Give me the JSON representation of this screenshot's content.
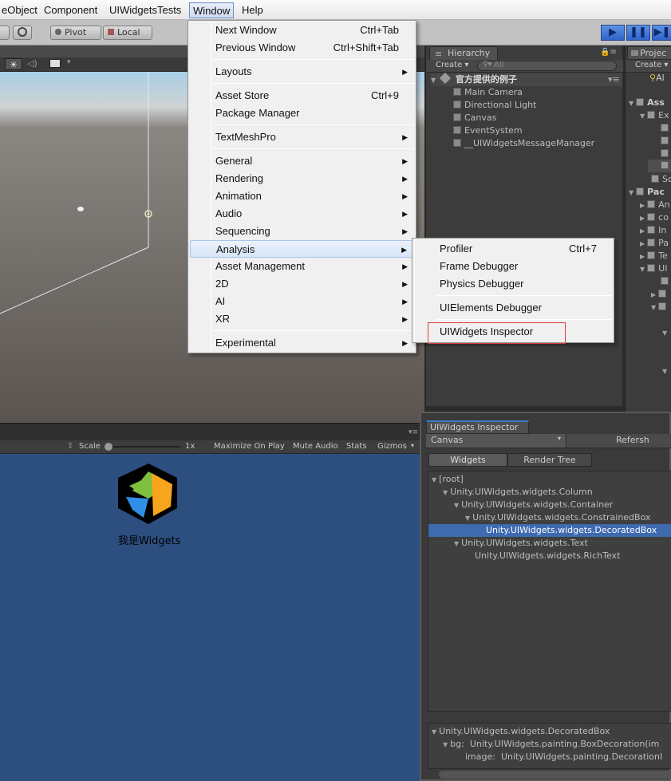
{
  "menubar": {
    "items": [
      "eObject",
      "Component",
      "UIWidgetsTests",
      "Window",
      "Help"
    ]
  },
  "toolbar": {
    "pivot": "Pivot",
    "local": "Local",
    "play_icon": "play-icon",
    "pause_icon": "pause-icon",
    "step_icon": "step-icon"
  },
  "window_menu": {
    "items": [
      {
        "label": "Next Window",
        "shortcut": "Ctrl+Tab"
      },
      {
        "label": "Previous Window",
        "shortcut": "Ctrl+Shift+Tab"
      },
      {
        "label": "Layouts",
        "shortcut": ""
      },
      {
        "label": "Asset Store",
        "shortcut": "Ctrl+9"
      },
      {
        "label": "Package Manager",
        "shortcut": ""
      },
      {
        "label": "TextMeshPro",
        "shortcut": ""
      },
      {
        "label": "General",
        "shortcut": ""
      },
      {
        "label": "Rendering",
        "shortcut": ""
      },
      {
        "label": "Animation",
        "shortcut": ""
      },
      {
        "label": "Audio",
        "shortcut": ""
      },
      {
        "label": "Sequencing",
        "shortcut": ""
      },
      {
        "label": "Analysis",
        "shortcut": ""
      },
      {
        "label": "Asset Management",
        "shortcut": ""
      },
      {
        "label": "2D",
        "shortcut": ""
      },
      {
        "label": "AI",
        "shortcut": ""
      },
      {
        "label": "XR",
        "shortcut": ""
      },
      {
        "label": "Experimental",
        "shortcut": ""
      }
    ]
  },
  "analysis_submenu": {
    "items": [
      {
        "label": "Profiler",
        "shortcut": "Ctrl+7"
      },
      {
        "label": "Frame Debugger",
        "shortcut": ""
      },
      {
        "label": "Physics Debugger",
        "shortcut": ""
      },
      {
        "label": "UIElements Debugger",
        "shortcut": ""
      },
      {
        "label": "UIWidgets Inspector",
        "shortcut": ""
      }
    ]
  },
  "hierarchy": {
    "tab": "Hierarchy",
    "create": "Create",
    "search_placeholder": "All",
    "scene": "官方提供的例子",
    "objects": [
      "Main Camera",
      "Directional Light",
      "Canvas",
      "EventSystem",
      "__UIWidgetsMessageManager"
    ]
  },
  "project": {
    "tab": "Projec",
    "create": "Create",
    "search": "Al",
    "rows": [
      "Ass",
      "Ex",
      "",
      "",
      "",
      "",
      "Sc",
      "Pac",
      "An",
      "co",
      "In",
      "Pa",
      "Te",
      "UI"
    ]
  },
  "game": {
    "scale_label": "Scale",
    "scale_value": "1x",
    "maximize": "Maximize On Play",
    "mute": "Mute Audio",
    "stats": "Stats",
    "gizmos": "Gizmos",
    "widget_text": "我是Widgets",
    "bg_color": "#2d4f80"
  },
  "inspector": {
    "tab": "UIWidgets Inspector",
    "panel_select": "Canvas",
    "refresh": "Refersh",
    "tabs": [
      "Widgets",
      "Render Tree"
    ],
    "tree": [
      "[root]",
      "Unity.UIWidgets.widgets.Column",
      "Unity.UIWidgets.widgets.Container",
      "Unity.UIWidgets.widgets.ConstrainedBox",
      "Unity.UIWidgets.widgets.DecoratedBox",
      "Unity.UIWidgets.widgets.Text",
      "Unity.UIWidgets.widgets.RichText"
    ],
    "details": {
      "title": "Unity.UIWidgets.widgets.DecoratedBox",
      "bg_label": "bg:",
      "bg_value": "Unity.UIWidgets.painting.BoxDecoration(im",
      "image_label": "image:",
      "image_value": "Unity.UIWidgets.painting.DecorationI"
    }
  },
  "colors": {
    "accent": "#3b7bd1",
    "selection": "#3e6ab0",
    "highlight_box": "#d94040"
  }
}
